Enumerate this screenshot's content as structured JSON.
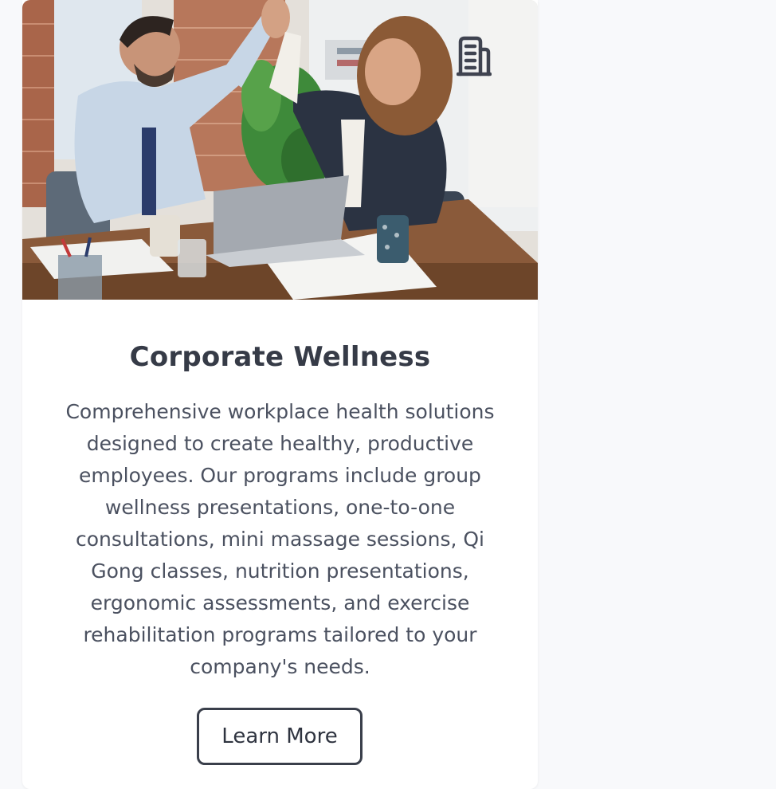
{
  "card": {
    "image_alt": "Two colleagues giving a high five at an office desk",
    "icon": "building-icon",
    "title": "Corporate Wellness",
    "description": "Comprehensive workplace health solutions designed to create healthy, productive employees. Our programs include group wellness presentations, one-to-one consultations, mini massage sessions, Qi Gong classes, nutrition presentations, ergonomic assessments, and exercise rehabilitation programs tailored to your company's needs.",
    "button_label": "Learn More"
  },
  "colors": {
    "page_background": "#f8f9fb",
    "card_background": "#ffffff",
    "title": "#363b47",
    "body_text": "#4b5160",
    "button_border": "#3a3f4b",
    "icon": "#3f4350"
  }
}
